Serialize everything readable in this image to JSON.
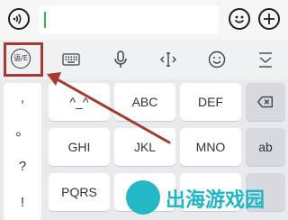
{
  "input_bar": {
    "text_value": "",
    "icons": [
      "voice-icon",
      "emoji-icon",
      "plus-icon"
    ]
  },
  "toolbar": {
    "lang_switch_label": "语/E",
    "tools": [
      "keyboard-icon",
      "microphone-icon",
      "cursor-move-icon",
      "emoji-icon",
      "collapse-keyboard-icon"
    ]
  },
  "punctuation": [
    ",",
    "。",
    "?",
    "!"
  ],
  "keys": {
    "row1": [
      "^_^",
      "ABC",
      "DEF"
    ],
    "row2": [
      "GHI",
      "JKL",
      "MNO",
      "ab"
    ],
    "row3": [
      "PQRS"
    ]
  },
  "backspace_icon": "backspace-icon",
  "watermark": "出海游戏园",
  "colors": {
    "highlight": "#a63a32",
    "caret": "#2dbb4f",
    "watermark": "#1eb6c7"
  }
}
